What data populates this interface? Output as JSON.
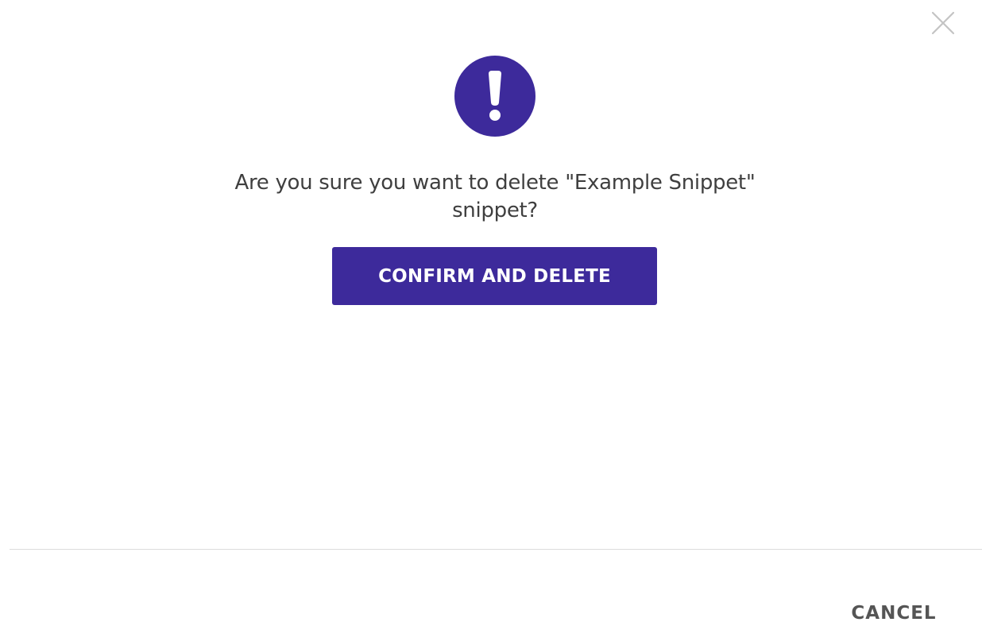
{
  "dialog": {
    "message": "Are you sure you want to delete \"Example Snippet\" snippet?",
    "confirm_label": "CONFIRM AND DELETE",
    "cancel_label": "CANCEL"
  },
  "icons": {
    "close": "close-icon",
    "alert": "exclamation-icon"
  },
  "colors": {
    "accent": "#3d2a9b",
    "text": "#3f3f3f",
    "muted": "#555555",
    "divider": "#dcdcdc",
    "close_icon": "#c4c4c4"
  }
}
